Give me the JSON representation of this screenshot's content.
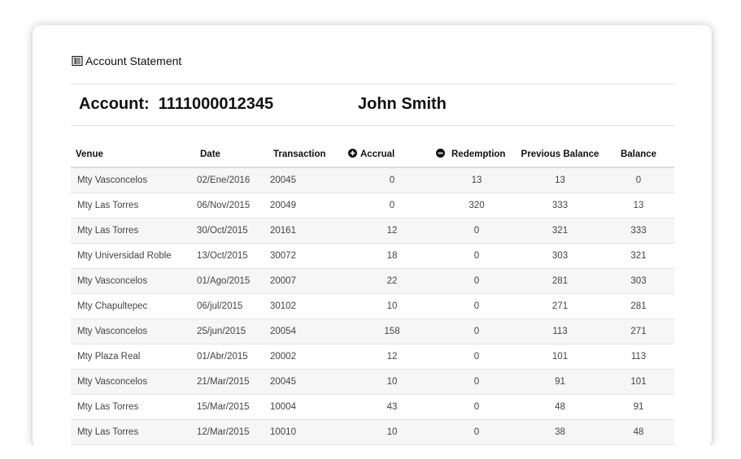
{
  "panel": {
    "title": "Account Statement",
    "icon": "list-document-icon"
  },
  "account": {
    "label": "Account:  1111000012345",
    "holder": "John Smith"
  },
  "table": {
    "headers": {
      "venue": "Venue",
      "date": "Date",
      "transaction": "Transaction",
      "accrual": "Accrual",
      "redemption": "Redemption",
      "previous_balance": "Previous Balance",
      "balance": "Balance"
    },
    "header_icons": {
      "accrual": "plus-circle-icon",
      "redemption": "minus-circle-icon"
    },
    "rows": [
      {
        "venue": "Mty Vasconcelos",
        "date": "02/Ene/2016",
        "transaction": "20045",
        "accrual": "0",
        "redemption": "13",
        "previous_balance": "13",
        "balance": "0"
      },
      {
        "venue": "Mty Las Torres",
        "date": "06/Nov/2015",
        "transaction": "20049",
        "accrual": "0",
        "redemption": "320",
        "previous_balance": "333",
        "balance": "13"
      },
      {
        "venue": "Mty Las Torres",
        "date": "30/Oct/2015",
        "transaction": "20161",
        "accrual": "12",
        "redemption": "0",
        "previous_balance": "321",
        "balance": "333"
      },
      {
        "venue": "Mty Universidad Roble",
        "date": "13/Oct/2015",
        "transaction": "30072",
        "accrual": "18",
        "redemption": "0",
        "previous_balance": "303",
        "balance": "321"
      },
      {
        "venue": "Mty Vasconcelos",
        "date": "01/Ago/2015",
        "transaction": "20007",
        "accrual": "22",
        "redemption": "0",
        "previous_balance": "281",
        "balance": "303"
      },
      {
        "venue": "Mty Chapultepec",
        "date": "06/jul/2015",
        "transaction": "30102",
        "accrual": "10",
        "redemption": "0",
        "previous_balance": "271",
        "balance": "281"
      },
      {
        "venue": "Mty Vasconcelos",
        "date": "25/jun/2015",
        "transaction": "20054",
        "accrual": "158",
        "redemption": "0",
        "previous_balance": "113",
        "balance": "271"
      },
      {
        "venue": "Mty Plaza Real",
        "date": "01/Abr/2015",
        "transaction": "20002",
        "accrual": "12",
        "redemption": "0",
        "previous_balance": "101",
        "balance": "113"
      },
      {
        "venue": "Mty Vasconcelos",
        "date": "21/Mar/2015",
        "transaction": "20045",
        "accrual": "10",
        "redemption": "0",
        "previous_balance": "91",
        "balance": "101"
      },
      {
        "venue": "Mty Las Torres",
        "date": "15/Mar/2015",
        "transaction": "10004",
        "accrual": "43",
        "redemption": "0",
        "previous_balance": "48",
        "balance": "91"
      },
      {
        "venue": "Mty Las Torres",
        "date": "12/Mar/2015",
        "transaction": "10010",
        "accrual": "10",
        "redemption": "0",
        "previous_balance": "38",
        "balance": "48"
      }
    ]
  },
  "colors": {
    "row_stripe": "#f6f6f6",
    "text": "#444444",
    "heading": "#111111"
  }
}
